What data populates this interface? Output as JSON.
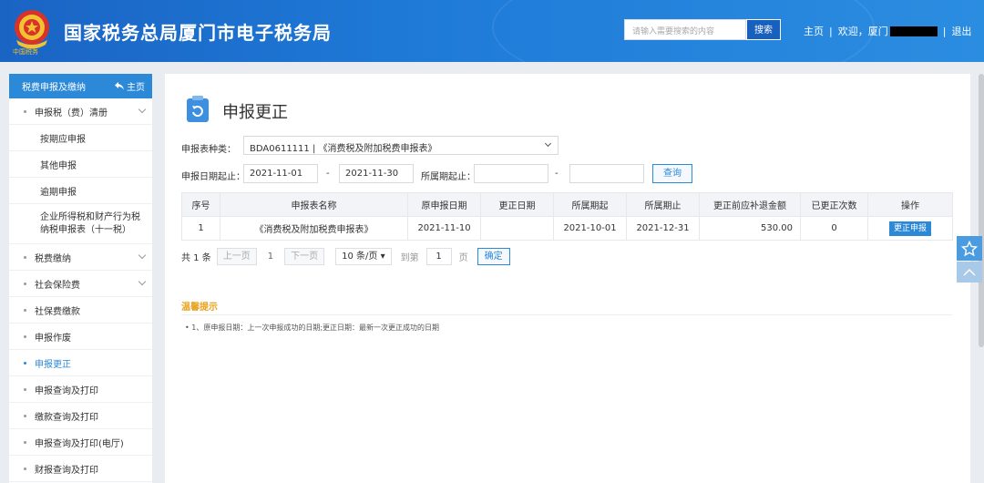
{
  "header": {
    "site_title": "国家税务总局厦门市电子税务局",
    "emblem_caption": "中国税务",
    "search_placeholder": "请输入需要搜索的内容",
    "search_button": "搜索",
    "nav_home": "主页",
    "nav_welcome": "欢迎，厦门",
    "nav_logout": "退出"
  },
  "sidebar": {
    "title": "税费申报及缴纳",
    "home": "主页",
    "items": [
      {
        "label": "申报税（费）清册",
        "type": "group"
      },
      {
        "label": "按期应申报",
        "type": "sub"
      },
      {
        "label": "其他申报",
        "type": "sub"
      },
      {
        "label": "逾期申报",
        "type": "sub"
      },
      {
        "label": "企业所得税和财产行为税纳税申报表（十一税）",
        "type": "sub-tall"
      },
      {
        "label": "税费缴纳",
        "type": "group"
      },
      {
        "label": "社会保险费",
        "type": "group"
      },
      {
        "label": "社保费缴款",
        "type": "item"
      },
      {
        "label": "申报作废",
        "type": "item"
      },
      {
        "label": "申报更正",
        "type": "active"
      },
      {
        "label": "申报查询及打印",
        "type": "item"
      },
      {
        "label": "缴款查询及打印",
        "type": "item"
      },
      {
        "label": "申报查询及打印(电厅)",
        "type": "item"
      },
      {
        "label": "财报查询及打印",
        "type": "item"
      }
    ]
  },
  "main": {
    "title": "申报更正",
    "form": {
      "type_label": "申报表种类：",
      "type_value": "BDA0611111 | 《消费税及附加税费申报表》",
      "date_label": "申报日期起止：",
      "date_from": "2021-11-01",
      "date_dash": "-",
      "date_to": "2021-11-30",
      "period_label": "所属期起止：",
      "period_dash": "-",
      "period_from": "",
      "period_to": "",
      "query_button": "查询"
    },
    "table": {
      "headers": [
        "序号",
        "申报表名称",
        "原申报日期",
        "更正日期",
        "所属期起",
        "所属期止",
        "更正前应补退金额",
        "已更正次数",
        "操作"
      ],
      "rows": [
        {
          "index": "1",
          "name": "《消费税及附加税费申报表》",
          "orig_date": "2021-11-10",
          "fix_date": "",
          "period_start": "2021-10-01",
          "period_end": "2021-12-31",
          "amount": "530.00",
          "count": "0",
          "action": "更正申报"
        }
      ]
    },
    "pager": {
      "total": "共 1 条",
      "prev": "上一页",
      "page": "1",
      "next": "下一页",
      "size": "10 条/页",
      "goto": "到第",
      "goto_value": "1",
      "page_unit": "页",
      "confirm": "确定"
    },
    "tips": {
      "title": "温馨提示",
      "text": "• 1、原申报日期：上一次申报成功的日期;更正日期：最新一次更正成功的日期"
    }
  },
  "colors": {
    "brand_blue": "#2c89d8",
    "header_blue": "#1f7bd8",
    "tip_orange": "#e8a21e"
  },
  "icons": [
    "emblem-icon",
    "home-icon",
    "chevron-down-icon",
    "page-refresh-icon",
    "star-icon",
    "arrow-up-icon"
  ]
}
